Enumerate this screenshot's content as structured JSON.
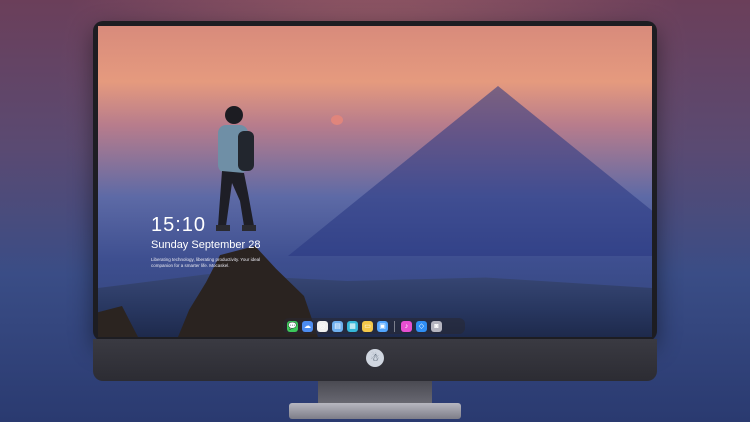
{
  "lockscreen": {
    "time": "15:10",
    "date": "Sunday September 28",
    "tagline": "Liberating technology, liberating productivity. Your ideal companion for a smarter life. Mocaskel."
  },
  "dock": {
    "icons": [
      {
        "name": "messages-icon",
        "glyph": "💬",
        "color": "#3cc85a"
      },
      {
        "name": "finder-icon",
        "glyph": "☁",
        "color": "#4c8cf0"
      },
      {
        "name": "safari-icon",
        "glyph": "◎",
        "color": "#f0f0f0"
      },
      {
        "name": "notes-icon",
        "glyph": "▤",
        "color": "#6fb0f0"
      },
      {
        "name": "clapper-icon",
        "glyph": "▦",
        "color": "#36b7d9"
      },
      {
        "name": "reminders-icon",
        "glyph": "▭",
        "color": "#f4c84a"
      },
      {
        "name": "photos-icon",
        "glyph": "▣",
        "color": "#52a6ff"
      },
      {
        "name": "music-icon",
        "glyph": "♪",
        "color": "#e74fd2"
      },
      {
        "name": "appstore-icon",
        "glyph": "◇",
        "color": "#2f8ff5"
      },
      {
        "name": "camera-icon",
        "glyph": "◙",
        "color": "#b5b5c0"
      }
    ]
  },
  "brand": {
    "logo": "☃"
  }
}
